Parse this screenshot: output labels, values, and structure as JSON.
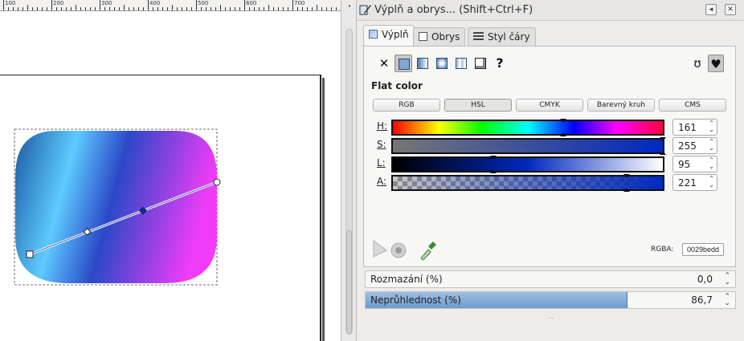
{
  "ruler": {
    "labels": [
      "100",
      "200",
      "300",
      "400",
      "500",
      "600",
      "700"
    ]
  },
  "dialog": {
    "title": "Výplň a obrys... (Shift+Ctrl+F)",
    "dock_glyph": "◂",
    "close_glyph": "✕",
    "tabs": [
      {
        "label": "Výplň",
        "icon": "fill-icon"
      },
      {
        "label": "Obrys",
        "icon": "stroke-paint-icon"
      },
      {
        "label": "Styl čáry",
        "icon": "stroke-style-icon"
      }
    ],
    "fill_modes": {
      "none_glyph": "✕",
      "unset_glyph": "?",
      "evenodd_glyph": "ʊ",
      "nonzero_glyph": "♥",
      "selected": "flat"
    },
    "flat_label": "Flat color",
    "color_modes": [
      "RGB",
      "HSL",
      "CMYK",
      "Barevný kruh",
      "CMS"
    ],
    "selected_color_mode": "HSL",
    "sliders": [
      {
        "label": "H:",
        "value": "161",
        "fraction": 0.6314
      },
      {
        "label": "S:",
        "value": "255",
        "fraction": 1.0
      },
      {
        "label": "L:",
        "value": "95",
        "fraction": 0.3725
      },
      {
        "label": "A:",
        "value": "221",
        "fraction": 0.8667
      }
    ],
    "rgba_label": "RGBA:",
    "rgba_value": "0029bedd",
    "blur": {
      "label": "Rozmazání (%)",
      "value": "0,0"
    },
    "opacity": {
      "label": "Neprůhlednost (%)",
      "value": "86,7",
      "fraction": 0.867
    },
    "grip": "..."
  },
  "colors": {
    "accent": "#0029be",
    "gradient_start": "#1b5a9e",
    "gradient_mid": "#5ec9ff",
    "gradient_end": "#f23cf7"
  }
}
